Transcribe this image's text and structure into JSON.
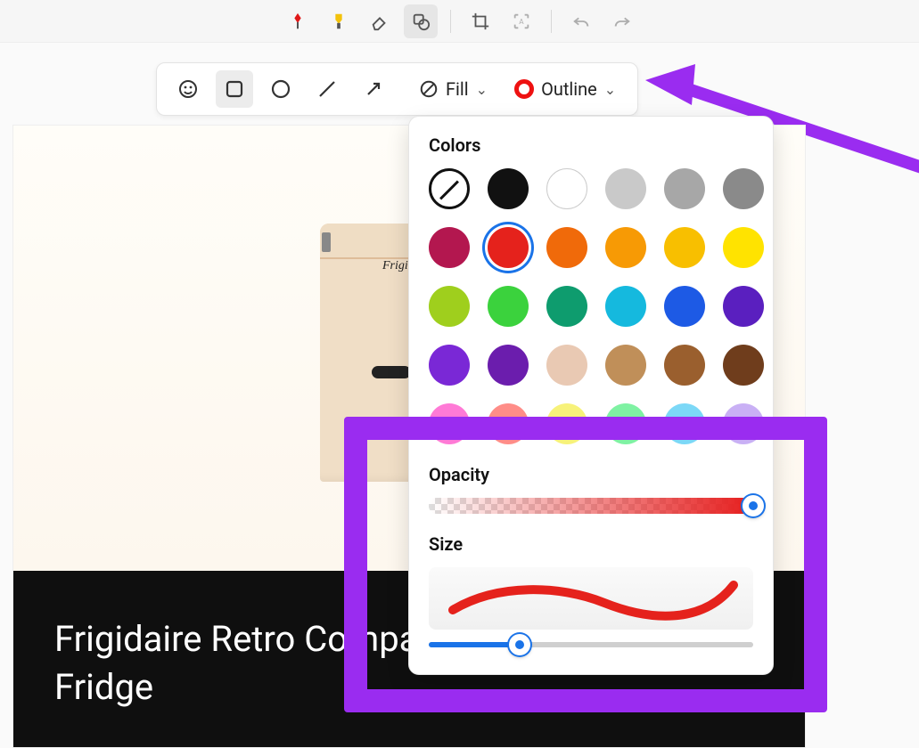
{
  "top_toolbar": {
    "tools": [
      {
        "name": "pen",
        "color": "#e01818"
      },
      {
        "name": "highlighter",
        "color": "#f3c20b"
      },
      {
        "name": "eraser"
      },
      {
        "name": "shapes",
        "active": true
      },
      {
        "name": "crop"
      },
      {
        "name": "scan",
        "disabled": true
      },
      {
        "name": "undo",
        "disabled": true
      },
      {
        "name": "redo",
        "disabled": true
      }
    ]
  },
  "shape_toolbar": {
    "shapes": [
      "emoji",
      "rectangle",
      "circle",
      "line",
      "arrow"
    ],
    "selected": "rectangle",
    "fill_label": "Fill",
    "outline_label": "Outline",
    "outline_color": "#e11"
  },
  "popover": {
    "colors_label": "Colors",
    "colors": [
      {
        "name": "none",
        "hex": null
      },
      {
        "name": "black",
        "hex": "#111111"
      },
      {
        "name": "white",
        "hex": "#ffffff",
        "white": true
      },
      {
        "name": "gray-light",
        "hex": "#c9c9c9"
      },
      {
        "name": "gray-mid",
        "hex": "#a7a7a7"
      },
      {
        "name": "gray-dark",
        "hex": "#8a8a8a"
      },
      {
        "name": "magenta",
        "hex": "#b3174f"
      },
      {
        "name": "red",
        "hex": "#e5221c",
        "selected": true
      },
      {
        "name": "orange",
        "hex": "#f06a0a"
      },
      {
        "name": "amber",
        "hex": "#f79a05"
      },
      {
        "name": "yellow-dark",
        "hex": "#f8bf00"
      },
      {
        "name": "yellow",
        "hex": "#ffe300"
      },
      {
        "name": "lime",
        "hex": "#9fcf1d"
      },
      {
        "name": "green",
        "hex": "#3bd23d"
      },
      {
        "name": "teal",
        "hex": "#0e9c6e"
      },
      {
        "name": "cyan",
        "hex": "#15b9de"
      },
      {
        "name": "blue",
        "hex": "#1d5ae5"
      },
      {
        "name": "indigo",
        "hex": "#5a1fbf"
      },
      {
        "name": "violet",
        "hex": "#7a28d6"
      },
      {
        "name": "purple",
        "hex": "#6b1dad"
      },
      {
        "name": "skin",
        "hex": "#e9c9b3"
      },
      {
        "name": "tan",
        "hex": "#c08f59"
      },
      {
        "name": "brown",
        "hex": "#9a5f2e"
      },
      {
        "name": "dark-brown",
        "hex": "#6f3d1c"
      },
      {
        "name": "pink",
        "hex": "#ff7ad6"
      },
      {
        "name": "salmon",
        "hex": "#ff8d88"
      },
      {
        "name": "lemon",
        "hex": "#f7f27a"
      },
      {
        "name": "mint",
        "hex": "#7ff2a3"
      },
      {
        "name": "aqua",
        "hex": "#7cd8f7"
      },
      {
        "name": "lilac",
        "hex": "#c9b0f5"
      }
    ],
    "opacity_label": "Opacity",
    "opacity": 100,
    "size_label": "Size",
    "size_percent": 28
  },
  "content": {
    "title": "Frigidaire Retro Compact Fridge",
    "title_visible": "Frigidaire Retro Compa\nFridge",
    "logo_text": "Frigidaire"
  },
  "annotation": {
    "arrow_color": "#9a2cf0",
    "highlight_color": "#9a2cf0"
  }
}
